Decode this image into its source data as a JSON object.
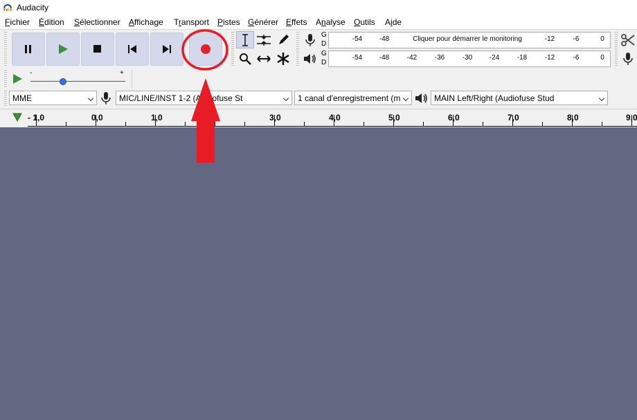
{
  "window": {
    "title": "Audacity"
  },
  "menu": [
    {
      "label": "Fichier",
      "accel": "F"
    },
    {
      "label": "Édition",
      "accel": "É"
    },
    {
      "label": "Sélectionner",
      "accel": "S"
    },
    {
      "label": "Affichage",
      "accel": "A"
    },
    {
      "label": "Transport",
      "accel": "r"
    },
    {
      "label": "Pistes",
      "accel": "P"
    },
    {
      "label": "Générer",
      "accel": "G"
    },
    {
      "label": "Effets",
      "accel": "E"
    },
    {
      "label": "Analyse",
      "accel": "n"
    },
    {
      "label": "Outils",
      "accel": "O"
    },
    {
      "label": "Aide",
      "accel": "i"
    }
  ],
  "transport": {
    "buttons": [
      "pause",
      "play",
      "stop",
      "skip-to-start",
      "skip-to-end",
      "record"
    ],
    "record_color": "#e0242c"
  },
  "meters": {
    "record": {
      "channel_top": "G",
      "channel_bottom": "D",
      "message": "Cliquer pour démarrer le monitoring",
      "ticks_left": [
        "-54",
        "-48"
      ],
      "ticks_right": [
        "-12",
        "-6",
        "0"
      ]
    },
    "playback": {
      "channel_top": "G",
      "channel_bottom": "D",
      "ticks": [
        "-54",
        "-48",
        "-42",
        "-36",
        "-30",
        "-24",
        "-18",
        "-12",
        "-6",
        "0"
      ]
    }
  },
  "play_at_speed": {
    "minus": "-",
    "plus": "+"
  },
  "device": {
    "host": "MME",
    "input": "MIC/LINE/INST 1-2 (Audiofuse St",
    "channels": "1 canal d'enregistrement (m",
    "output": "MAIN Left/Right (Audiofuse Stud"
  },
  "ruler": {
    "labels": [
      "- 1,0",
      "0,0",
      "1,0",
      "3,0",
      "4,0",
      "5,0",
      "6,0",
      "7,0",
      "8,0",
      "9,0"
    ]
  },
  "colors": {
    "track_background": "#636782",
    "button_face": "#d3d9eb",
    "annotation_red": "#e81c24"
  }
}
